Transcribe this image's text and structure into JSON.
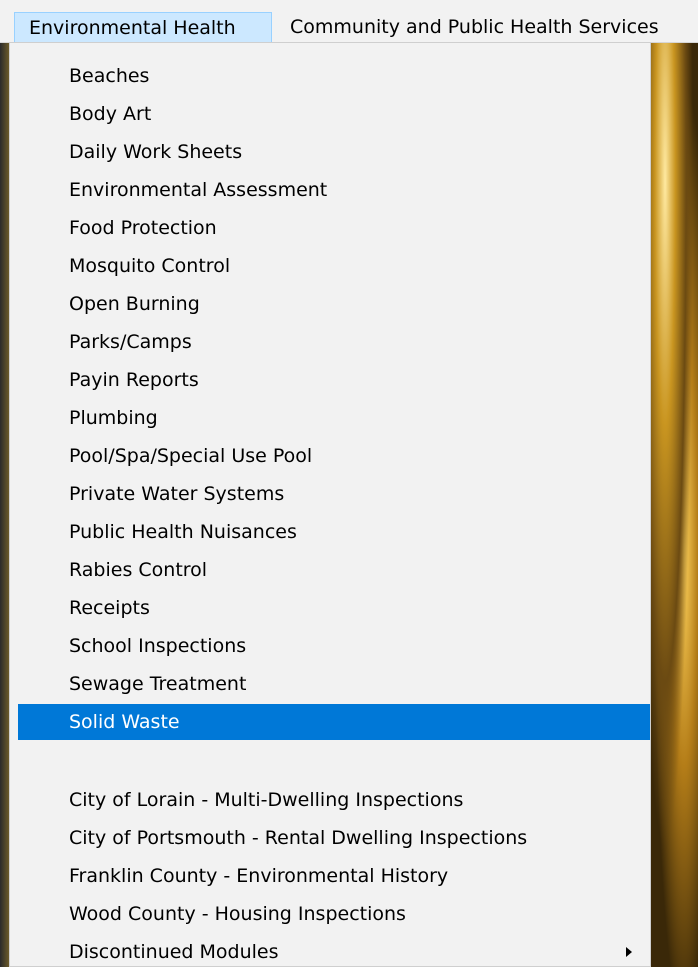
{
  "menubar": {
    "items": [
      {
        "label": "Environmental Health"
      },
      {
        "label": "Community and Public Health Services"
      }
    ]
  },
  "dropdown": {
    "items": [
      {
        "label": "Beaches"
      },
      {
        "label": "Body Art"
      },
      {
        "label": "Daily Work Sheets"
      },
      {
        "label": "Environmental Assessment"
      },
      {
        "label": "Food Protection"
      },
      {
        "label": "Mosquito Control"
      },
      {
        "label": "Open Burning"
      },
      {
        "label": "Parks/Camps"
      },
      {
        "label": "Payin Reports"
      },
      {
        "label": "Plumbing"
      },
      {
        "label": "Pool/Spa/Special Use Pool"
      },
      {
        "label": "Private Water Systems"
      },
      {
        "label": "Public Health Nuisances"
      },
      {
        "label": "Rabies Control"
      },
      {
        "label": "Receipts"
      },
      {
        "label": "School Inspections"
      },
      {
        "label": "Sewage Treatment"
      },
      {
        "label": "Solid Waste"
      }
    ],
    "extra_items": [
      {
        "label": "City of Lorain - Multi-Dwelling Inspections"
      },
      {
        "label": "City of Portsmouth - Rental Dwelling Inspections"
      },
      {
        "label": "Franklin County - Environmental History"
      },
      {
        "label": "Wood County - Housing Inspections"
      },
      {
        "label": "Discontinued Modules"
      }
    ]
  },
  "colors": {
    "highlight": "#0078d7",
    "menu_background": "#f2f2f2",
    "active_menubar_item": "#cce8ff"
  },
  "icons": {
    "submenu_arrow": "chevron-right-icon"
  }
}
